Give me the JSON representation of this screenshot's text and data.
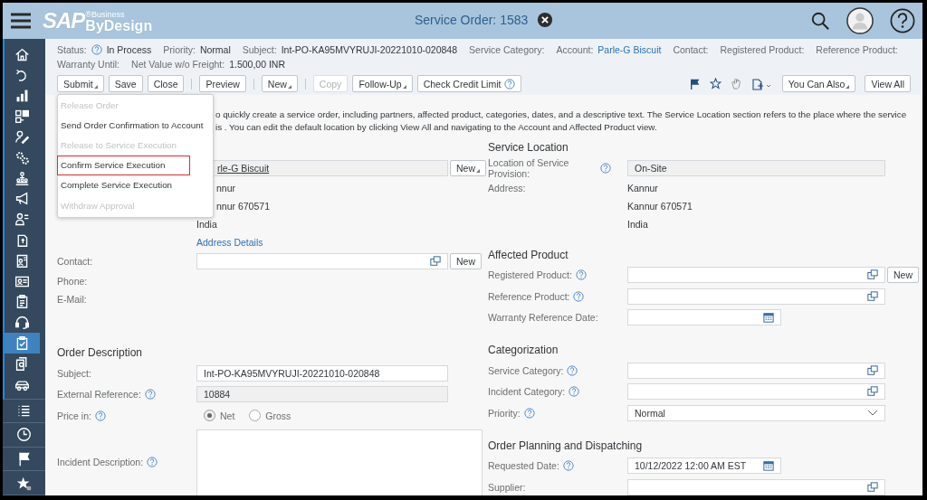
{
  "header": {
    "logo": {
      "brand": "SAP",
      "super": "®Business",
      "product": "ByDesign"
    },
    "title": "Service Order: 1583"
  },
  "sidebar": {
    "items": [
      {
        "selected": false
      },
      {
        "selected": false
      },
      {
        "selected": false
      },
      {
        "selected": false
      },
      {
        "selected": false
      },
      {
        "selected": false
      },
      {
        "selected": false
      },
      {
        "selected": false
      },
      {
        "selected": false
      },
      {
        "selected": false
      },
      {
        "selected": false
      },
      {
        "selected": false
      },
      {
        "selected": false
      },
      {
        "selected": false
      },
      {
        "selected": true
      },
      {
        "selected": false
      },
      {
        "selected": false
      }
    ],
    "bottom_items": [
      {
        "selected": false
      },
      {
        "selected": false
      },
      {
        "selected": false
      },
      {
        "selected": false
      }
    ]
  },
  "info": {
    "rows": [
      [
        {
          "label": "Status:",
          "help": true,
          "value": "In Process"
        },
        {
          "label": "Priority:",
          "value": "Normal"
        },
        {
          "label": "Subject:",
          "value": "Int-PO-KA95MVYRUJI-20221010-020848"
        },
        {
          "label": "Service Category:"
        },
        {
          "label": "Account:",
          "value": "Parle-G Biscuit",
          "link": true
        },
        {
          "label": "Contact:"
        },
        {
          "label": "Registered Product:"
        },
        {
          "label": "Reference Product:"
        }
      ],
      [
        {
          "label": "Warranty Until:"
        },
        {
          "label": "Net Value w/o Freight:",
          "value": "1.500,00 INR"
        }
      ]
    ]
  },
  "toolbar": {
    "left": [
      {
        "label": "Submit",
        "menu": true,
        "disabled": false
      },
      {
        "label": "Save",
        "menu": false,
        "disabled": false
      },
      {
        "label": "Close",
        "menu": false,
        "disabled": false
      },
      {
        "label": "Preview",
        "menu": false,
        "disabled": false,
        "separator_before": true
      },
      {
        "label": "New",
        "menu": true,
        "disabled": false,
        "separator_before": true
      },
      {
        "label": "Copy",
        "menu": false,
        "disabled": true,
        "separator_before": true
      },
      {
        "label": "Follow-Up",
        "menu": true,
        "disabled": false
      },
      {
        "label": "Check Credit Limit",
        "menu": false,
        "disabled": false,
        "help": true
      }
    ],
    "right": [
      {
        "label": "You Can Also",
        "menu": true
      },
      {
        "label": "View All",
        "menu": false
      }
    ]
  },
  "submit_menu": {
    "items": [
      {
        "label": "Release Order",
        "disabled": true,
        "highlighted": false
      },
      {
        "label": "Send Order Confirmation to Account",
        "disabled": false,
        "highlighted": false
      },
      {
        "label": "Release to Service Execution",
        "disabled": true,
        "highlighted": false
      },
      {
        "label": "Confirm Service Execution",
        "disabled": false,
        "highlighted": true
      },
      {
        "label": "Complete Service Execution",
        "disabled": false,
        "highlighted": false
      },
      {
        "label": "Withdraw Approval",
        "disabled": true,
        "highlighted": false
      }
    ]
  },
  "description": "o quickly create a service order, including partners, affected product, categories, dates, and a descriptive text. The Service Location section refers to the place where the service is . You can edit the default location by clicking View All and navigating to the Account and Affected Product view.",
  "left_column": [
    {
      "kind": "readonly",
      "value": "rle-G Biscuit",
      "underline": true,
      "covered": true,
      "button": "New",
      "button_menu": true
    },
    {
      "kind": "text",
      "value": "nnur",
      "covered": true
    },
    {
      "kind": "text",
      "value": "nnur 670571",
      "covered": true
    },
    {
      "kind": "text",
      "value": "India"
    },
    {
      "kind": "link",
      "value": "Address Details"
    },
    {
      "kind": "lookup",
      "label": "Contact:",
      "button": "New",
      "button_menu": false
    },
    {
      "kind": "text",
      "label": "Phone:"
    },
    {
      "kind": "text",
      "label": "E-Mail:"
    },
    {
      "kind": "heading",
      "label": "Order Description"
    },
    {
      "kind": "input",
      "label": "Subject:",
      "value": "Int-PO-KA95MVYRUJI-20221010-020848"
    },
    {
      "kind": "readonly",
      "label": "External Reference:",
      "help": true,
      "value": "10884"
    },
    {
      "kind": "radio",
      "label": "Price in:",
      "help": true,
      "options": [
        {
          "label": "Net",
          "selected": true
        },
        {
          "label": "Gross",
          "selected": false
        }
      ]
    },
    {
      "kind": "textarea",
      "label": "Incident Description:",
      "help": true
    }
  ],
  "right_column": [
    {
      "kind": "heading",
      "label": "Service Location"
    },
    {
      "kind": "readonly",
      "label": "Location of Service Provision:",
      "help": true,
      "value": "On-Site"
    },
    {
      "kind": "text",
      "label": "Address:",
      "value": "Kannur"
    },
    {
      "kind": "text",
      "value": "Kannur 670571"
    },
    {
      "kind": "text",
      "value": "India"
    },
    {
      "kind": "heading",
      "label": "Affected Product"
    },
    {
      "kind": "lookup",
      "label": "Registered Product:",
      "help": true,
      "button": "New",
      "button_menu": false
    },
    {
      "kind": "lookup",
      "label": "Reference Product:",
      "help": true
    },
    {
      "kind": "date",
      "label": "Warranty Reference Date:"
    },
    {
      "kind": "heading",
      "label": "Categorization"
    },
    {
      "kind": "lookup",
      "label": "Service Category:",
      "help": true
    },
    {
      "kind": "lookup",
      "label": "Incident Category:",
      "help": true
    },
    {
      "kind": "select",
      "label": "Priority:",
      "help": true,
      "value": "Normal"
    },
    {
      "kind": "heading",
      "label": "Order Planning and Dispatching"
    },
    {
      "kind": "date",
      "label": "Requested Date:",
      "help": true,
      "value": "10/12/2022 12:00 AM EST"
    },
    {
      "kind": "lookup",
      "label": "Supplier:"
    }
  ]
}
